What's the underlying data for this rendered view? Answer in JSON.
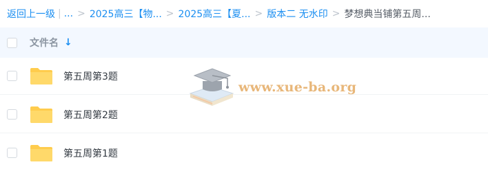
{
  "breadcrumb": {
    "back_label": "返回上一级",
    "ellipsis": "...",
    "items": [
      "2025高三【物...",
      "2025高三【夏...",
      "版本二 无水印"
    ],
    "current": "梦想典当铺第五周..."
  },
  "table": {
    "column_name": "文件名",
    "sort_icon": "arrow-down-icon",
    "rows": [
      {
        "name": "第五周第3题",
        "icon": "folder-icon"
      },
      {
        "name": "第五周第2题",
        "icon": "folder-icon"
      },
      {
        "name": "第五周第1题",
        "icon": "folder-icon"
      }
    ]
  },
  "watermark": {
    "text": "www.xue-ba.org",
    "icon": "graduation-cap-icon"
  },
  "colors": {
    "link": "#1a8ef1",
    "header_bg": "#f3f8ff",
    "folder": "#ffd45a",
    "watermark_text": "#e8b77a"
  }
}
